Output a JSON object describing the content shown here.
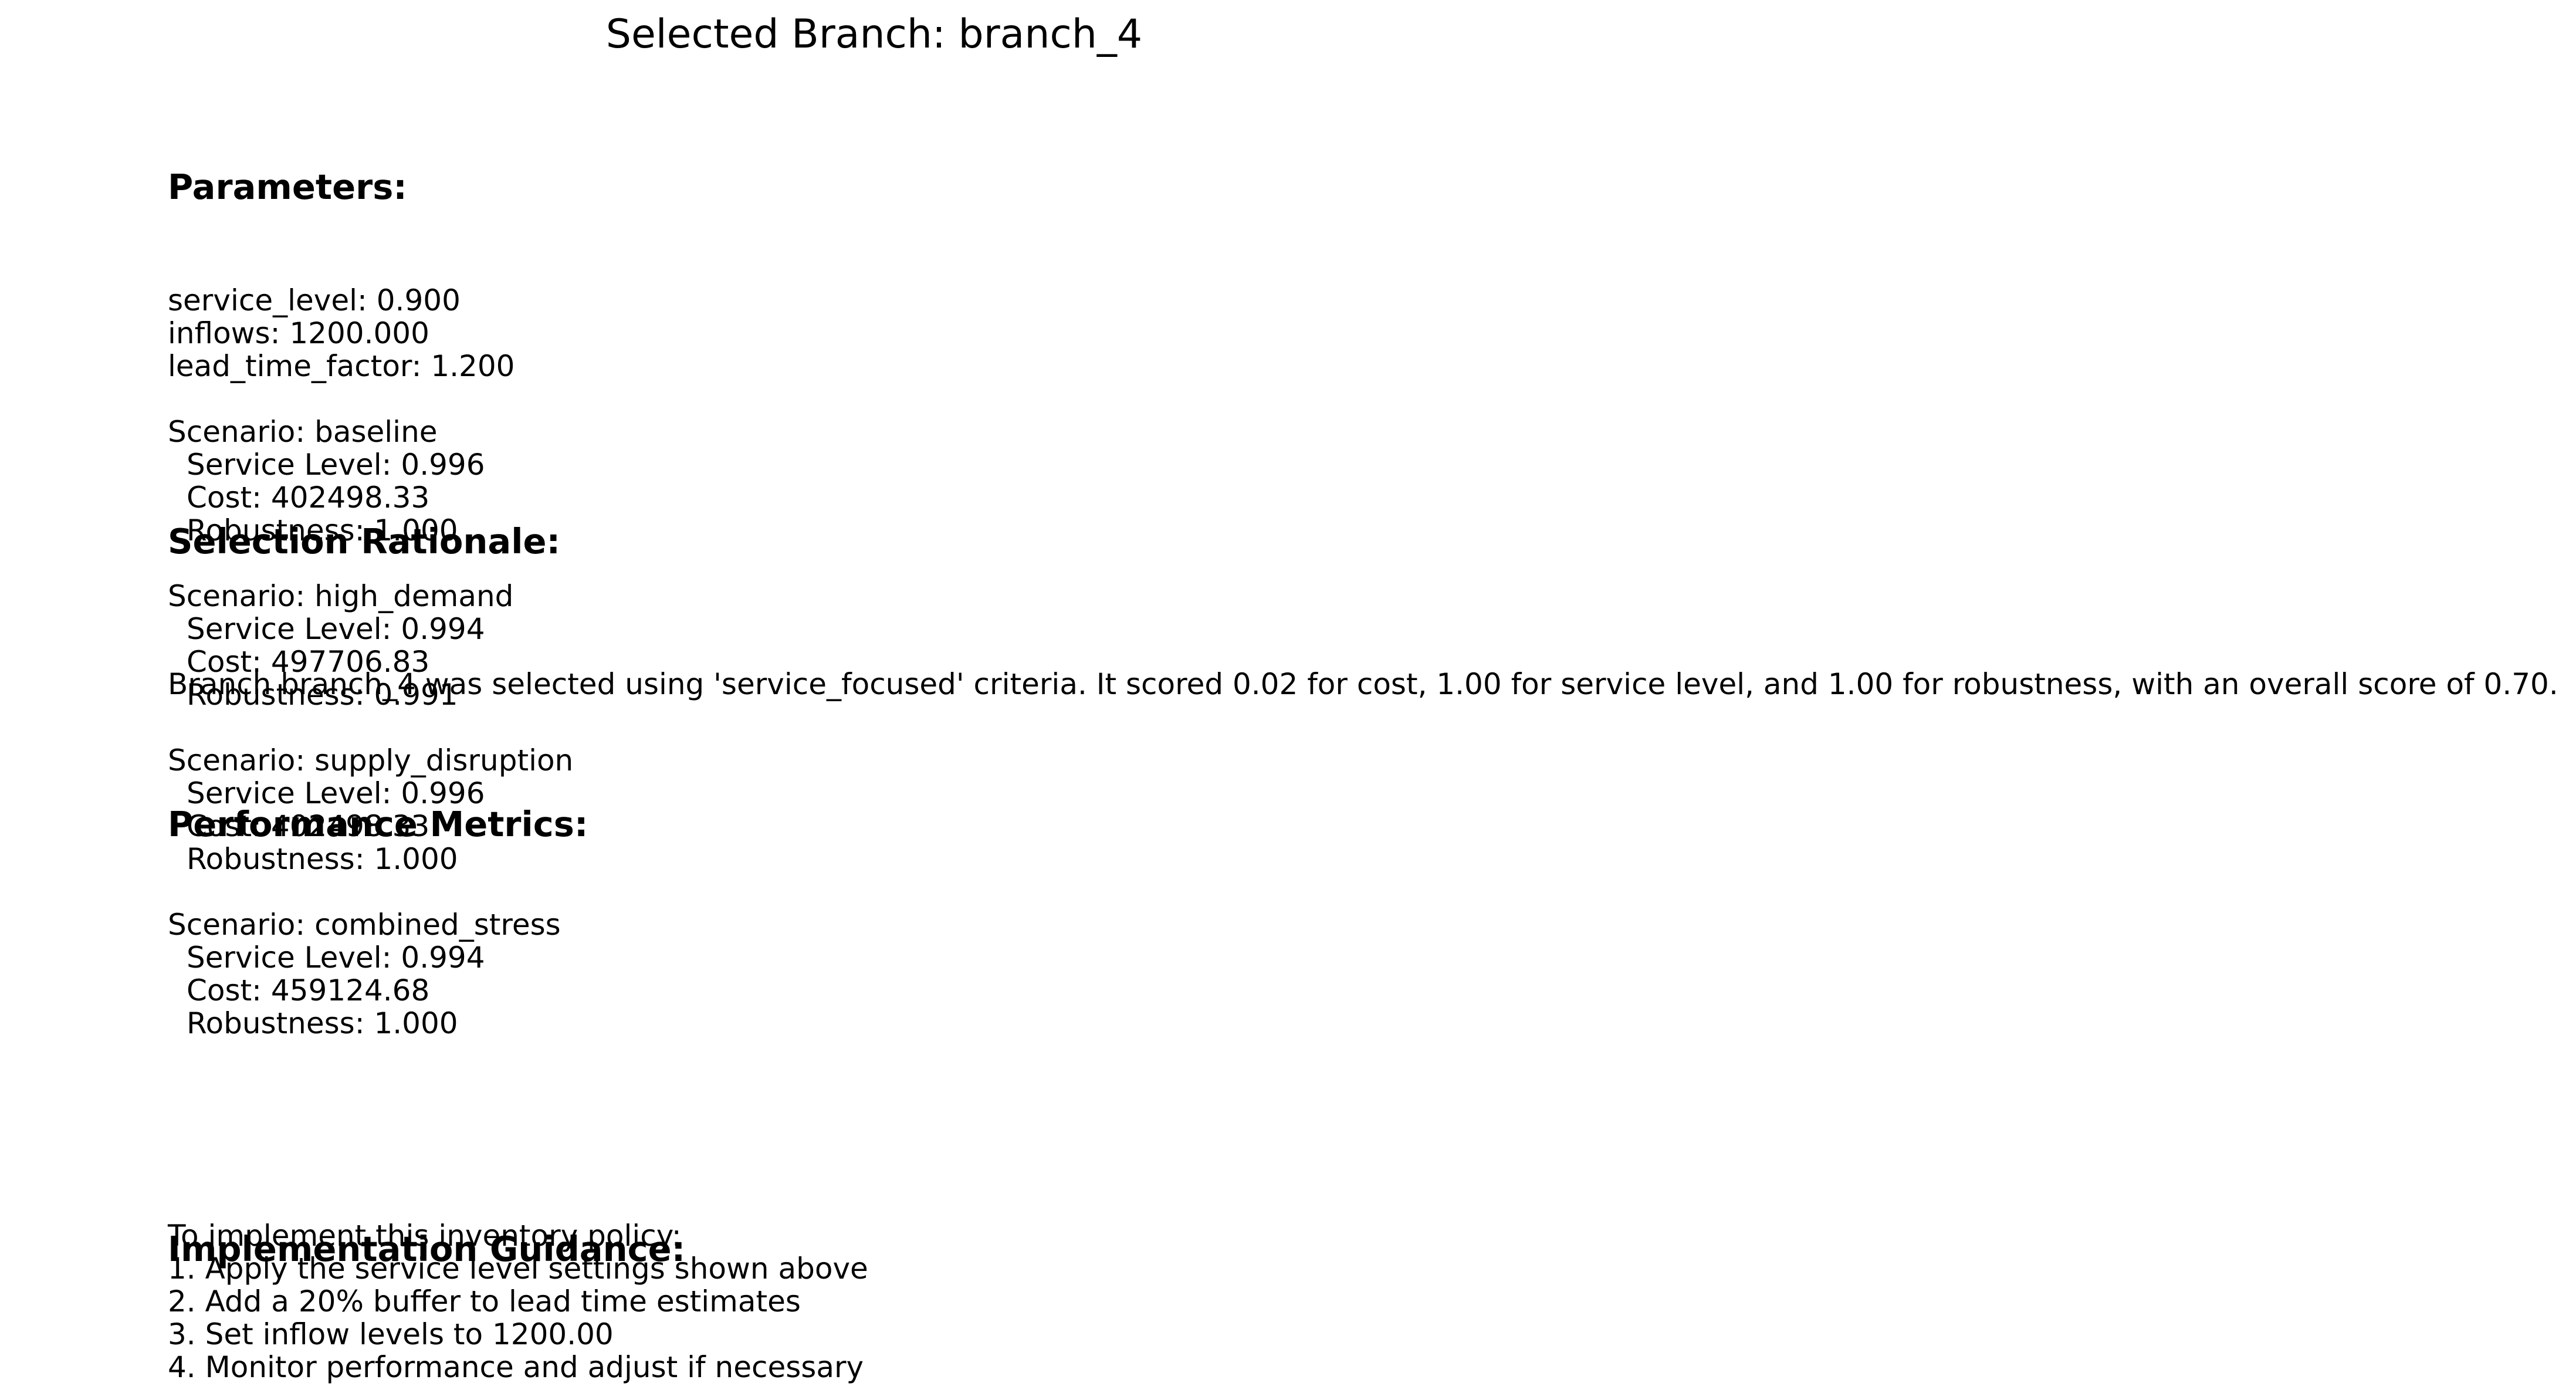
{
  "title": "Selected Branch: branch_4",
  "parameters": {
    "heading": "Parameters:",
    "items": [
      "service_level: 0.900",
      "inflows: 1200.000",
      "lead_time_factor: 1.200"
    ]
  },
  "scenarios": [
    {
      "name": "Scenario: baseline",
      "service_level": "Service Level: 0.996",
      "cost": "Cost: 402498.33",
      "robustness": "Robustness: 1.000"
    },
    {
      "name": "Scenario: high_demand",
      "service_level": "Service Level: 0.994",
      "cost": "Cost: 497706.83",
      "robustness": "Robustness: 0.991"
    },
    {
      "name": "Scenario: supply_disruption",
      "service_level": "Service Level: 0.996",
      "cost": "Cost: 402498.33",
      "robustness": "Robustness: 1.000"
    },
    {
      "name": "Scenario: combined_stress",
      "service_level": "Service Level: 0.994",
      "cost": "Cost: 459124.68",
      "robustness": "Robustness: 1.000"
    }
  ],
  "rationale": {
    "heading": "Selection Rationale:",
    "text": "Branch branch_4 was selected using 'service_focused' criteria. It scored 0.02 for cost, 1.00 for service level, and 1.00 for robustness, with an overall score of 0.70."
  },
  "performance": {
    "heading": "Performance Metrics:"
  },
  "implementation": {
    "heading": "Implementation Guidance:",
    "lines": [
      "To implement this inventory policy:",
      "1. Apply the service level settings shown above",
      "2. Add a 20% buffer to lead time estimates",
      "3. Set inflow levels to 1200.00",
      "4. Monitor performance and adjust if necessary"
    ]
  }
}
